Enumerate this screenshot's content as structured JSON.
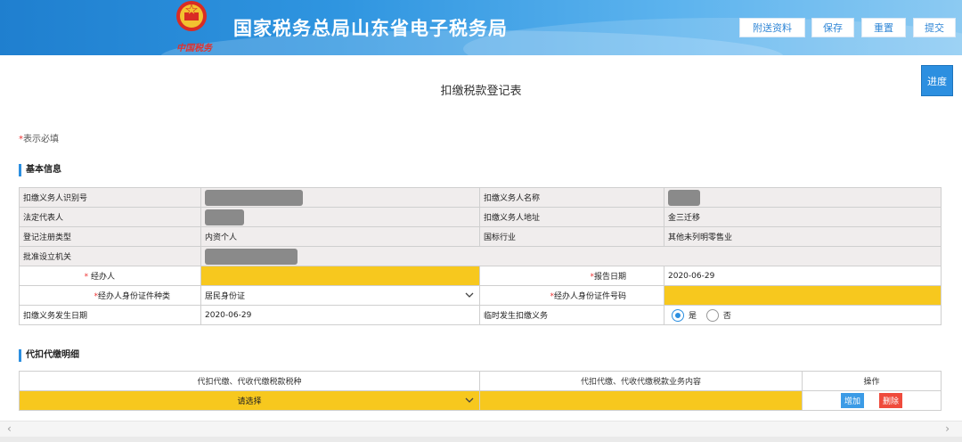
{
  "header": {
    "title": "国家税务总局山东省电子税务局",
    "emblem_subtitle": "中国税务",
    "buttons": [
      "附送资料",
      "保存",
      "重置",
      "提交"
    ]
  },
  "progress_label": "进度",
  "page_title": "扣缴税款登记表",
  "required_note": {
    "star": "*",
    "text": "表示必填"
  },
  "basic_info": {
    "section_title": "基本信息",
    "rows": [
      {
        "l1": "扣缴义务人识别号",
        "v1": "",
        "l2": "扣缴义务人名称",
        "v2": ""
      },
      {
        "l1": "法定代表人",
        "v1": "",
        "l2": "扣缴义务人地址",
        "v2": "金三迁移"
      },
      {
        "l1": "登记注册类型",
        "v1": "内资个人",
        "l2": "国标行业",
        "v2": "其他未列明零售业"
      },
      {
        "l1": "批准设立机关",
        "v1": ""
      }
    ],
    "agent_label": "经办人",
    "agent_value": "",
    "report_date_label": "报告日期",
    "report_date_value": "2020-06-29",
    "id_type_label": "经办人身份证件种类",
    "id_type_value": "居民身份证",
    "id_number_label": "经办人身份证件号码",
    "id_number_value": "",
    "obligation_date_label": "扣缴义务发生日期",
    "obligation_date_value": "2020-06-29",
    "temp_label": "临时发生扣缴义务",
    "temp_yes": "是",
    "temp_no": "否",
    "temp_selected": "是",
    "required_star": "*"
  },
  "detail": {
    "section_title": "代扣代缴明细",
    "headers": [
      "代扣代缴、代收代缴税款税种",
      "代扣代缴、代收代缴税款业务内容",
      "操作"
    ],
    "tax_select_placeholder": "请选择",
    "business_content": "",
    "add_label": "增加",
    "delete_label": "删除"
  },
  "colors": {
    "accent": "#2c8fe0",
    "required": "#f7c81e",
    "danger": "#ef4b3c"
  }
}
